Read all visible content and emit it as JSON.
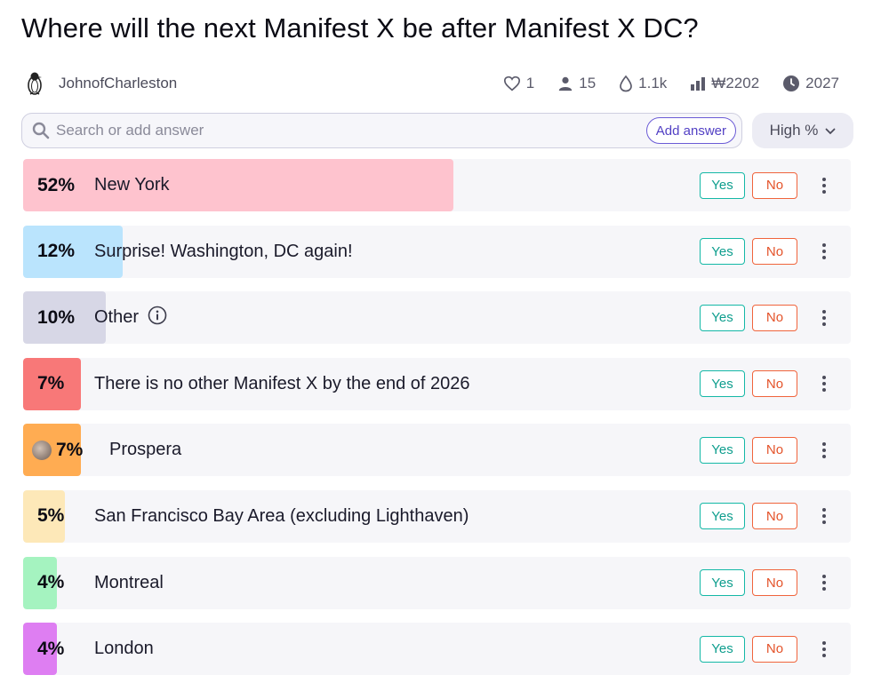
{
  "question": {
    "title": "Where will the next Manifest X be after Manifest X DC?"
  },
  "author": {
    "name": "JohnofCharleston",
    "avatar_icon": "penguin-avatar-icon"
  },
  "stats": {
    "likes": "1",
    "traders": "15",
    "volume": "1.1k",
    "liquidity": "₩2202",
    "close": "2027"
  },
  "search": {
    "placeholder": "Search or add answer",
    "value": "",
    "add_label": "Add answer"
  },
  "sort": {
    "label": "High %"
  },
  "buttons": {
    "yes": "Yes",
    "no": "No"
  },
  "colors": {
    "yes": "#14b8a6",
    "no": "#f0643c",
    "accent": "#5240c4"
  },
  "answers": [
    {
      "pct_label": "52%",
      "prob": 0.52,
      "text": "New York",
      "color": "#fec3ce",
      "info": false,
      "avatar": false
    },
    {
      "pct_label": "12%",
      "prob": 0.12,
      "text": "Surprise! Washington, DC again!",
      "color": "#bae4fd",
      "info": false,
      "avatar": false
    },
    {
      "pct_label": "10%",
      "prob": 0.1,
      "text": "Other",
      "color": "#d7d7e6",
      "info": true,
      "avatar": false
    },
    {
      "pct_label": "7%",
      "prob": 0.07,
      "text": "There is no other Manifest X by the end of 2026",
      "color": "#f87878",
      "info": false,
      "avatar": false
    },
    {
      "pct_label": "7%",
      "prob": 0.07,
      "text": "Prospera",
      "color": "#ffac52",
      "info": false,
      "avatar": true
    },
    {
      "pct_label": "5%",
      "prob": 0.05,
      "text": "San Francisco Bay Area (excluding Lighthaven)",
      "color": "#fde8b8",
      "info": false,
      "avatar": false
    },
    {
      "pct_label": "4%",
      "prob": 0.04,
      "text": "Montreal",
      "color": "#a5f3c0",
      "info": false,
      "avatar": false
    },
    {
      "pct_label": "4%",
      "prob": 0.04,
      "text": "London",
      "color": "#de7ef2",
      "info": false,
      "avatar": false
    }
  ]
}
